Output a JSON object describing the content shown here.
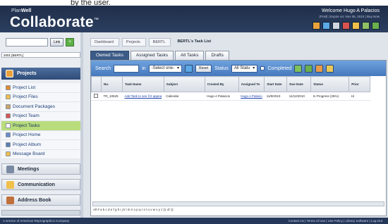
{
  "caption": "by the user.",
  "header": {
    "brand_prefix": "Plan",
    "brand_prefix_bold": "Well",
    "brand_name": "Collaborate",
    "trademark": "™",
    "welcome": "Welcome Hugo A Palacios",
    "welcome_sub": "(Prail) | Expire on: Nov 06, 2010 | Buy Now",
    "icons": [
      "search-icon",
      "home-icon",
      "print-icon",
      "mail-icon",
      "folder-icon",
      "chart-icon",
      "help-icon"
    ],
    "icon_colors": [
      "#e9a23b",
      "#5aa9e6",
      "#cfd6e0",
      "#d9534f",
      "#f0c04a",
      "#8fc163",
      "#6ab04c"
    ]
  },
  "sidebar": {
    "search_button": "Link",
    "project_field": "2001 [BERTL]",
    "projects_label": "Projects",
    "sub_items": [
      {
        "label": "Project List",
        "icon": "list-icon",
        "color": "#e38b2f"
      },
      {
        "label": "Project Files",
        "icon": "files-icon",
        "color": "#f0c04a"
      },
      {
        "label": "Document Packages",
        "icon": "package-icon",
        "color": "#c9a36a"
      },
      {
        "label": "Project Team",
        "icon": "team-icon",
        "color": "#d9534f"
      },
      {
        "label": "Project Tasks",
        "icon": "tasks-icon",
        "color": "#ffffff"
      },
      {
        "label": "Project Home",
        "icon": "home-icon",
        "color": "#6a8cc7"
      },
      {
        "label": "Project Album",
        "icon": "album-icon",
        "color": "#5a7fb0"
      },
      {
        "label": "Message Board",
        "icon": "message-icon",
        "color": "#f0c04a"
      }
    ],
    "sections": [
      {
        "label": "Meetings",
        "icon": "meetings-icon",
        "color": "#7b8aa3"
      },
      {
        "label": "Communication",
        "icon": "communication-icon",
        "color": "#f0c04a"
      },
      {
        "label": "Address Book",
        "icon": "address-book-icon",
        "color": "#c0703a"
      }
    ]
  },
  "breadcrumb": [
    "Dashboard",
    "Projects",
    "BERTL",
    "BERTL's Task List"
  ],
  "tabs": [
    "Owned Tasks",
    "Assigned Tasks",
    "All Tasks",
    "Drafts"
  ],
  "toolbar": {
    "search_label": "Search",
    "in_label": "in",
    "select_value": "-Select one-",
    "reset_label": "Reset",
    "status_label": "Status",
    "status_value": "All Statu",
    "completed_label": "Completed"
  },
  "table": {
    "columns": [
      "No.",
      "Task Name",
      "Subject",
      "Created By",
      "Assigned To",
      "Start Date",
      "Due Date",
      "Status",
      "Prior"
    ],
    "rows": [
      {
        "no": "TR_10525",
        "task_name": "Add Task to see if it appea",
        "subject": "Calendar",
        "created_by": "Hugo A Palacios",
        "assigned_to": "Hugo A Palacio",
        "start_date": "11/9/2010",
        "due_date": "11/12/2010",
        "status": "In Progress (25%)",
        "priority": "Hi"
      }
    ]
  },
  "alpha_nav": "All # a b c d e f g h i j k l m n o p q r s t u v w x y z [1 of 1]",
  "footer": {
    "left": "A service of American Reprographics Company",
    "right": "Contact Us | Terms of Use | Use Policy | Library Software | Log Out"
  },
  "colors": {
    "header": "#1f2e4a",
    "toolbar": "#4679bd",
    "selected_nav": "#b9dc7c",
    "active_tab": "#3c5b87"
  }
}
